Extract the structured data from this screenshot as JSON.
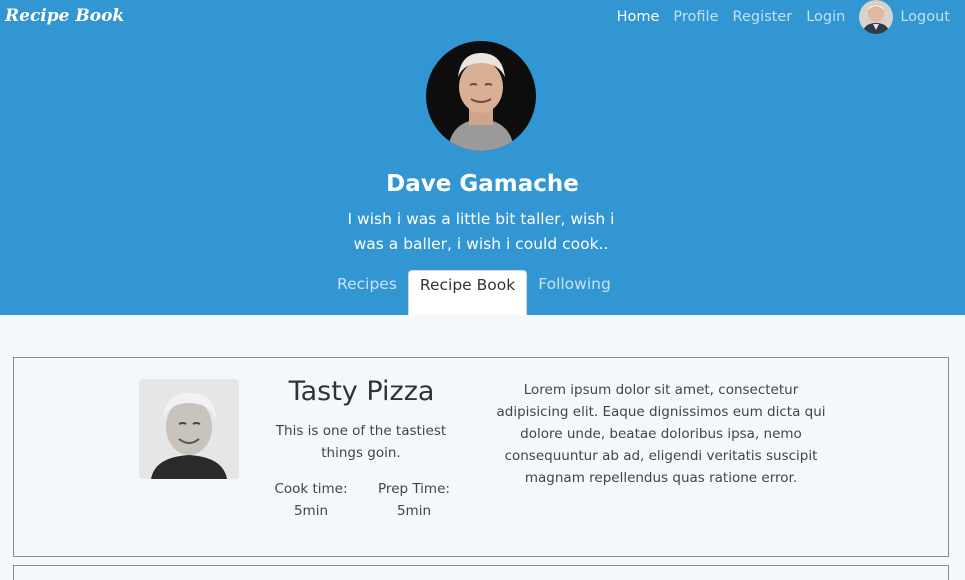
{
  "brand": "Recipe Book",
  "nav": {
    "home": "Home",
    "profile": "Profile",
    "register": "Register",
    "login": "Login",
    "logout": "Logout"
  },
  "profile": {
    "name": "Dave Gamache",
    "bio": "I wish i was a little bit taller, wish i was a baller, i wish i could cook.."
  },
  "tabs": [
    "Recipes",
    "Recipe Book",
    "Following"
  ],
  "recipe": {
    "title": "Tasty Pizza",
    "description": "This is one of the tastiest things goin.",
    "cook_label": "Cook time:",
    "cook_value": "5min",
    "prep_label": "Prep Time:",
    "prep_value": "5min",
    "body": "Lorem ipsum dolor sit amet, consectetur adipisicing elit. Eaque dignissimos eum dicta qui dolore unde, beatae doloribus ipsa, nemo consequuntur ab ad, eligendi veritatis suscipit magnam repellendus quas ratione error."
  },
  "colors": {
    "header": "#3296d3",
    "page_bg": "#f5f8fb"
  },
  "icons": {
    "nav_avatar": "user-avatar-photo",
    "profile_avatar": "profile-photo",
    "recipe_photo": "recipe-photo"
  }
}
